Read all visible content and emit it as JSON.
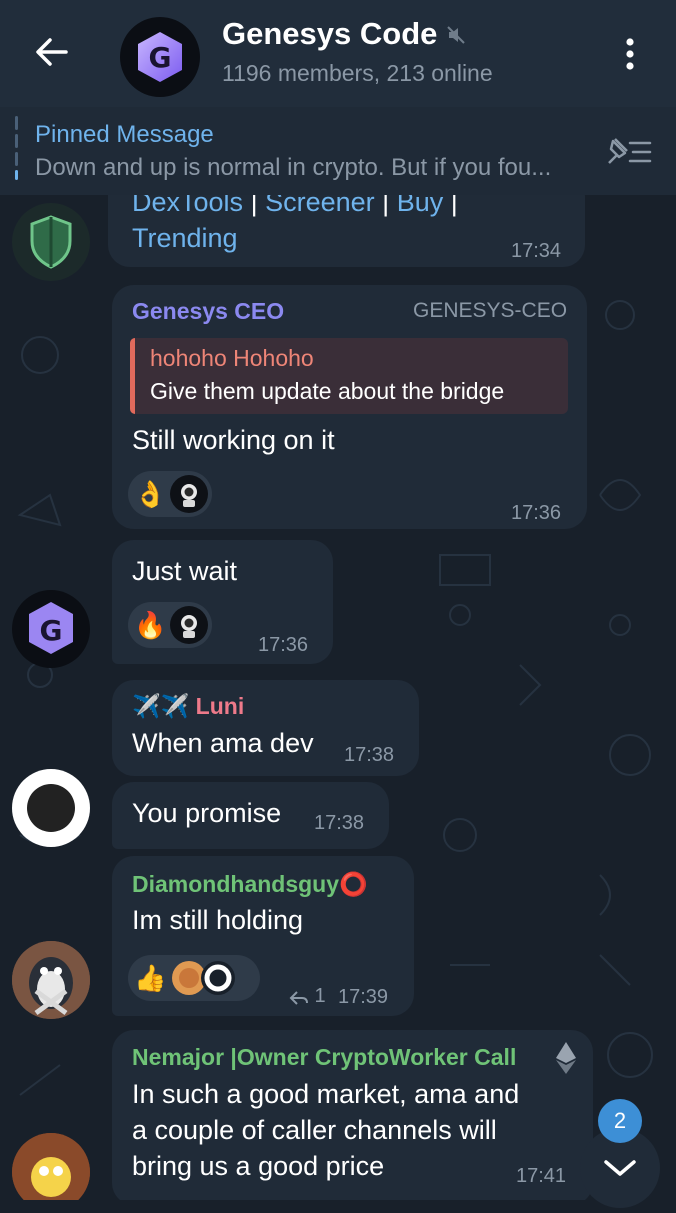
{
  "header": {
    "title": "Genesys Code",
    "subtitle": "1196 members, 213 online",
    "logo_letter": "G"
  },
  "pinned": {
    "title": "Pinned Message",
    "text": "Down and up is normal in crypto. But if you fou..."
  },
  "messages": {
    "m1": {
      "links": [
        "DexTools",
        "Screener",
        "Buy",
        "Trending"
      ],
      "separator": "|",
      "time": "17:34"
    },
    "m2": {
      "sender": "Genesys CEO",
      "role": "GENESYS-CEO",
      "reply_name": "hohoho Hohoho",
      "reply_text": "Give them update about the bridge",
      "text": "Still working on it",
      "reaction": "👌",
      "time": "17:36"
    },
    "m3": {
      "text": "Just wait",
      "reaction": "🔥",
      "time": "17:36"
    },
    "m4": {
      "sender_prefix": "✈️✈️",
      "sender": "Luni",
      "text": "When ama dev",
      "time": "17:38"
    },
    "m5": {
      "text": "You promise",
      "time": "17:38"
    },
    "m6": {
      "sender": "Diamondhandsguy⭕",
      "text": "Im still holding",
      "reaction": "👍",
      "reply_count": "1",
      "time": "17:39"
    },
    "m7": {
      "sender": "Nemajor |Owner CryptoWorker Call",
      "line1": "In such a good market, ama and",
      "line2": "a couple of caller channels will",
      "line3": "bring us a good price",
      "time": "17:41"
    }
  },
  "scroll": {
    "unread_count": "2"
  },
  "colors": {
    "background": "#18202a",
    "header": "#212d3b",
    "bubble": "#202b38",
    "link": "#6fb3ec",
    "ceo_name": "#8b89f0",
    "luni_name": "#ee7a8a",
    "diamond_name": "#6fc377",
    "nemajor_name": "#6fc377",
    "unread_badge": "#3d8fd6"
  }
}
